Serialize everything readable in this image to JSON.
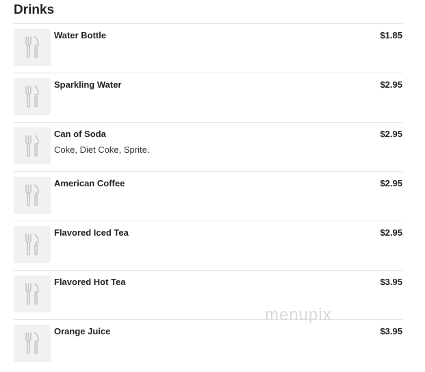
{
  "section": {
    "title": "Drinks"
  },
  "items": [
    {
      "name": "Water Bottle",
      "price": "$1.85",
      "description": "",
      "icon": "cutlery-icon"
    },
    {
      "name": "Sparkling Water",
      "price": "$2.95",
      "description": "",
      "icon": "cutlery-icon"
    },
    {
      "name": "Can of Soda",
      "price": "$2.95",
      "description": "Coke, Diet Coke, Sprite.",
      "icon": "cutlery-icon"
    },
    {
      "name": "American Coffee",
      "price": "$2.95",
      "description": "",
      "icon": "cutlery-icon"
    },
    {
      "name": "Flavored Iced Tea",
      "price": "$2.95",
      "description": "",
      "icon": "cutlery-icon"
    },
    {
      "name": "Flavored Hot Tea",
      "price": "$3.95",
      "description": "",
      "icon": "cutlery-icon"
    },
    {
      "name": "Orange Juice",
      "price": "$3.95",
      "description": "",
      "icon": "cutlery-icon"
    }
  ],
  "watermark": "menupix",
  "colors": {
    "divider": "#e3e3e3",
    "thumb_bg": "#f1f1f1",
    "icon": "#c4c4c4",
    "text": "#222222"
  }
}
